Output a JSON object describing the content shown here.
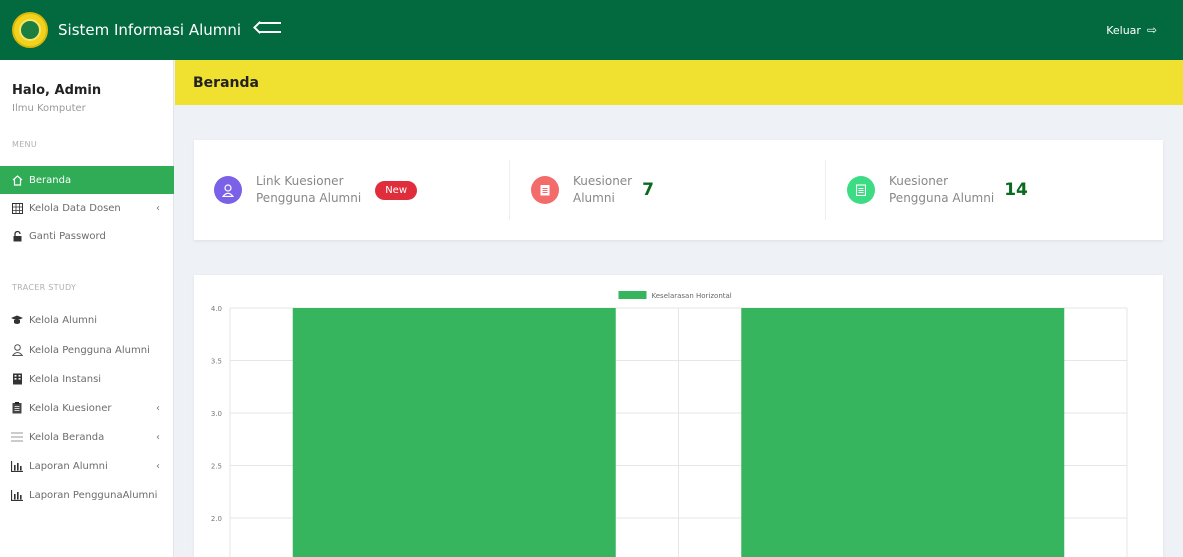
{
  "topbar": {
    "app_title": "Sistem Informasi Alumni",
    "logout_label": "Keluar",
    "logout_icon": "sign-out-icon",
    "bg_color": "#036a40"
  },
  "sidebar": {
    "greeting": "Halo, Admin",
    "prodi": "Ilmu Komputer",
    "menu_label": "MENU",
    "menu_items": [
      {
        "label": "Beranda",
        "icon": "home-icon",
        "active": true
      },
      {
        "label": "Kelola Data Dosen",
        "icon": "table-icon",
        "has_submenu": true
      },
      {
        "label": "Ganti Password",
        "icon": "unlock-icon"
      }
    ],
    "tracer_label": "TRACER STUDY",
    "tracer_items": [
      {
        "label": "Kelola Alumni",
        "icon": "graduate-icon"
      },
      {
        "label": "Kelola Pengguna Alumni",
        "icon": "user-icon"
      },
      {
        "label": "Kelola Instansi",
        "icon": "building-icon"
      },
      {
        "label": "Kelola Kuesioner",
        "icon": "clipboard-icon",
        "has_submenu": true
      },
      {
        "label": "Kelola Beranda",
        "icon": "list-icon",
        "has_submenu": true
      },
      {
        "label": "Laporan Alumni",
        "icon": "bar-chart-icon",
        "has_submenu": true
      },
      {
        "label": "Laporan PenggunaAlumni",
        "icon": "bar-chart-icon"
      }
    ],
    "chevron": "‹",
    "active_color": "#2fac55"
  },
  "page_header": {
    "title": "Beranda",
    "bg_color": "#f0e030"
  },
  "stats": [
    {
      "line1": "Link Kuesioner",
      "line2": "Pengguna Alumni",
      "badge": "New",
      "icon": "user-icon",
      "color": "#7b61e8"
    },
    {
      "line1": "Kuesioner",
      "line2": "Alumni",
      "value": "7",
      "icon": "clipboard-icon",
      "color": "#f36b6b"
    },
    {
      "line1": "Kuesioner",
      "line2": "Pengguna Alumni",
      "value": "14",
      "icon": "clipboard-icon",
      "color": "#3ddc84"
    }
  ],
  "chart_data": {
    "type": "bar",
    "series": [
      {
        "name": "Keselarasan Horizontal",
        "values": [
          4.0,
          4.0
        ],
        "color": "#37b55e"
      }
    ],
    "categories": [
      "",
      ""
    ],
    "yticks": [
      "4.0",
      "3.5",
      "3.0",
      "2.5",
      "2.0"
    ],
    "ylim_visible": [
      1.8,
      4.0
    ],
    "legend_position": "top-center",
    "grid": true
  }
}
